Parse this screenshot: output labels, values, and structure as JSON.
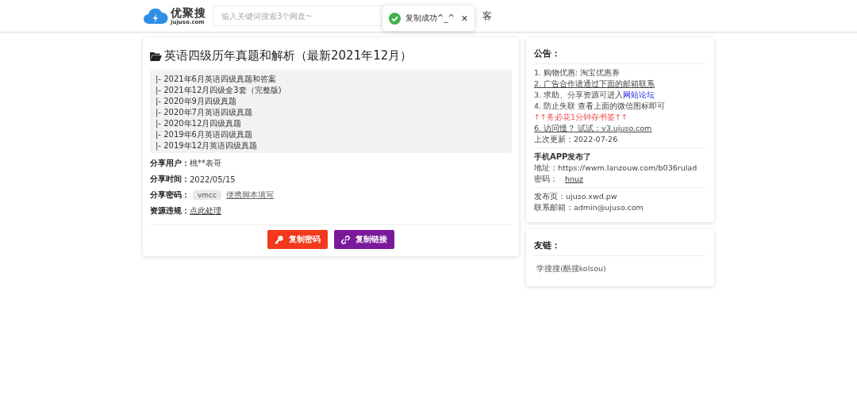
{
  "header": {
    "logo_name": "优聚搜",
    "logo_domain": "jujuso.com",
    "search": {
      "placeholder": "输入关键词搜索3个网盘~"
    },
    "nav_text": "客"
  },
  "toast": {
    "message": "复制成功^_^",
    "close": "✕"
  },
  "resource": {
    "title": "英语四级历年真题和解析（最新2021年12月）",
    "files": [
      "|- 2021年6月英语四级真题和答案",
      "|- 2021年12月四级全3套（完整版)",
      "|- 2020年9月四级真题",
      "|- 2020年7月英语四级真题",
      "|- 2020年12月四级真题",
      "|- 2019年6月英语四级真题",
      "|- 2019年12月英语四级真题"
    ],
    "fields": [
      {
        "label": "分享用户：",
        "kind": "text",
        "value": "桃**表哥"
      },
      {
        "label": "分享时间：",
        "kind": "text",
        "value": "2022/05/15"
      },
      {
        "label": "分享密码：",
        "kind": "code",
        "value": "vmcc",
        "link": "便携脚本填写"
      },
      {
        "label": "资源违规：",
        "kind": "link",
        "value": "点此处理"
      }
    ],
    "buttons": [
      {
        "label": "复制密码",
        "kind": "key"
      },
      {
        "label": "复制链接",
        "kind": "link"
      }
    ]
  },
  "notice": {
    "title": "公告：",
    "items": [
      {
        "kind": "text",
        "text": "1. 购物优惠: 淘宝优惠券"
      },
      {
        "kind": "link",
        "text": "2. 广告合作请通过下面的邮箱联系"
      },
      {
        "kind": "mixed",
        "text": "3. 求助、分享资源可进入",
        "link": "网站论坛"
      },
      {
        "kind": "text",
        "text": "4. 防止失联 查看上面的微信图标即可"
      },
      {
        "kind": "alert",
        "text": "↑↑务必花1分钟存书签↑↑"
      },
      {
        "kind": "link",
        "text": "6. 访问慢？ 试试：v3.ujuso.com"
      },
      {
        "kind": "text",
        "text": "上次更新：2022-07-26"
      }
    ],
    "app_title": "手机APP发布了",
    "app_lines": [
      {
        "label": "地址：",
        "value": "https://wwm.lanzouw.com/b036rulad",
        "kind": "text"
      },
      {
        "label": "密码：",
        "value": "hnuz",
        "kind": "link"
      }
    ],
    "contact": [
      "发布页：ujuso.xwd.pw",
      "联系邮箱：admin@ujuso.com"
    ]
  },
  "friends": {
    "title": "友链：",
    "links": [
      "学搜搜(酷搜kolsou)"
    ]
  }
}
